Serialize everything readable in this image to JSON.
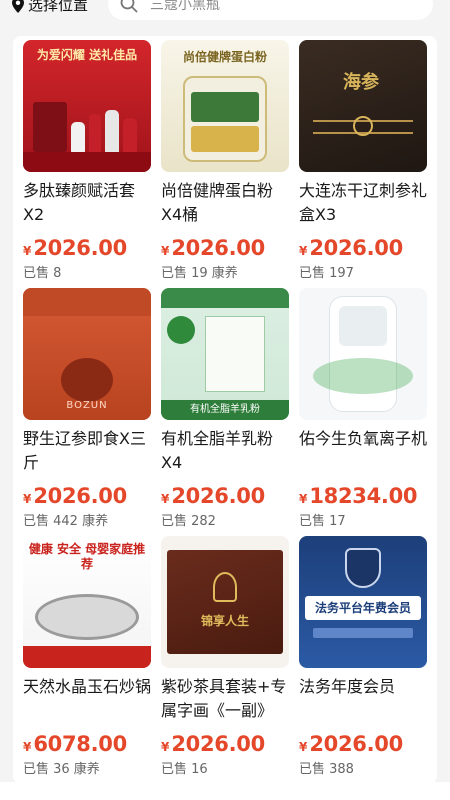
{
  "header": {
    "location_label": "选择位置",
    "search_placeholder": "三蔻小黑瓶"
  },
  "products": [
    {
      "title": "多肽臻颜赋活套X2",
      "currency": "¥",
      "price": "2026.00",
      "sold": "已售 8",
      "image_text": "为爱闪耀 送礼佳品"
    },
    {
      "title": "尚倍健牌蛋白粉X4桶",
      "currency": "¥",
      "price": "2026.00",
      "sold": "已售 19 康养",
      "image_text": "尚倍健牌蛋白粉"
    },
    {
      "title": "大连冻干辽刺参礼盒X3",
      "currency": "¥",
      "price": "2026.00",
      "sold": "已售 197",
      "image_text": "海参"
    },
    {
      "title": "野生辽参即食X三斤",
      "currency": "¥",
      "price": "2026.00",
      "sold": "已售 442 康养",
      "image_text": "BOZUN"
    },
    {
      "title": "有机全脂羊乳粉X4",
      "currency": "¥",
      "price": "2026.00",
      "sold": "已售 282",
      "image_text": "有机全脂羊乳粉"
    },
    {
      "title": "佑今生负氧离子机",
      "currency": "¥",
      "price": "18234.00",
      "sold": "已售 17",
      "image_text": ""
    },
    {
      "title": "天然水晶玉石炒锅",
      "currency": "¥",
      "price": "6078.00",
      "sold": "已售 36 康养",
      "image_text": "健康 安全 母婴家庭推荐"
    },
    {
      "title": "紫砂茶具套装+专属字画《一副》",
      "currency": "¥",
      "price": "2026.00",
      "sold": "已售 16",
      "image_text": "锦享人生"
    },
    {
      "title": "法务年度会员",
      "currency": "¥",
      "price": "2026.00",
      "sold": "已售 388",
      "image_text": "法务平台年费会员"
    }
  ],
  "colors": {
    "price": "#e4472a",
    "background": "#f4f4f4"
  }
}
